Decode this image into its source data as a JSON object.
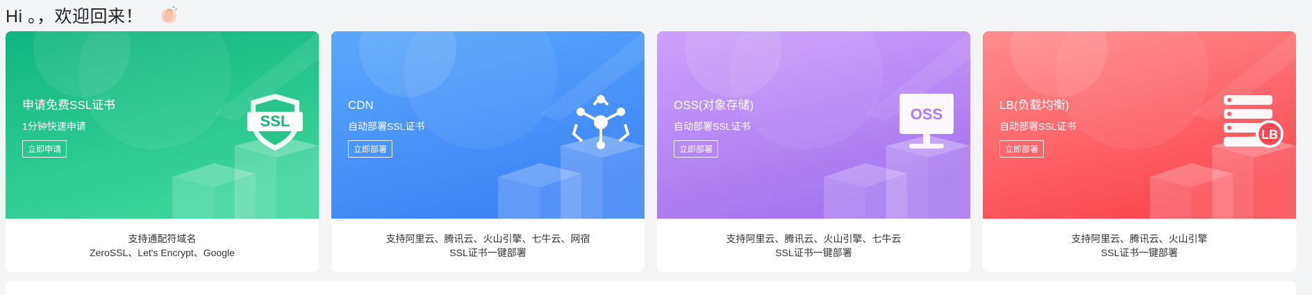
{
  "greeting": {
    "text": "Hi 。，欢迎回来！",
    "icon": "clapping-hands-icon"
  },
  "cards": [
    {
      "id": "ssl",
      "title": "申请免费SSL证书",
      "subtitle": "1分钟快速申请",
      "button": "立即申请",
      "icon": "ssl-shield-icon",
      "icon_text": "SSL",
      "colors": [
        "#11b57f",
        "#3ad49b"
      ],
      "footer": [
        "支持通配符域名",
        "ZeroSSL、Let's Encrypt、Google"
      ]
    },
    {
      "id": "cdn",
      "title": "CDN",
      "subtitle": "自动部署SSL证书",
      "button": "立即部署",
      "icon": "cdn-network-icon",
      "colors": [
        "#5aa8fb",
        "#3f84f6"
      ],
      "footer": [
        "支持阿里云、腾讯云、火山引擎、七牛云、网宿",
        "SSL证书一键部署"
      ]
    },
    {
      "id": "oss",
      "title": "OSS(对象存储)",
      "subtitle": "自动部署SSL证书",
      "button": "立即部署",
      "icon": "oss-monitor-icon",
      "icon_text": "OSS",
      "colors": [
        "#cfa0fb",
        "#a676ef"
      ],
      "footer": [
        "支持阿里云、腾讯云、火山引擎、七牛云",
        "SSL证书一键部署"
      ]
    },
    {
      "id": "lb",
      "title": "LB(负载均衡)",
      "subtitle": "自动部署SSL证书",
      "button": "立即部署",
      "icon": "lb-server-icon",
      "icon_text": "LB",
      "colors": [
        "#ff8d8e",
        "#fb4a53"
      ],
      "footer": [
        "支持阿里云、腾讯云、火山引擎",
        "SSL证书一键部署"
      ]
    }
  ]
}
